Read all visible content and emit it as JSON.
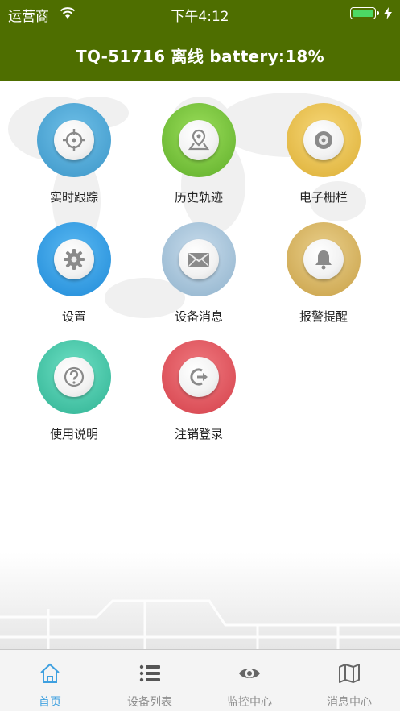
{
  "status_bar": {
    "carrier": "运营商",
    "time": "下午4:12"
  },
  "header": {
    "title": "TQ-51716 离线 battery:18%"
  },
  "menu": [
    {
      "label": "实时跟踪",
      "icon": "crosshair-icon",
      "color": "#4aa6d6"
    },
    {
      "label": "历史轨迹",
      "icon": "map-pin-icon",
      "color": "#7cc63c"
    },
    {
      "label": "电子栅栏",
      "icon": "disc-icon",
      "color": "#e9c14d"
    },
    {
      "label": "设置",
      "icon": "gear-icon",
      "color": "#2d9fe8"
    },
    {
      "label": "设备消息",
      "icon": "envelope-icon",
      "color": "#a9c6dc"
    },
    {
      "label": "报警提醒",
      "icon": "bell-icon",
      "color": "#d9b663"
    },
    {
      "label": "使用说明",
      "icon": "question-icon",
      "color": "#3ec7a8"
    },
    {
      "label": "注销登录",
      "icon": "logout-icon",
      "color": "#e0505a"
    }
  ],
  "tabs": [
    {
      "label": "首页",
      "icon": "home-icon",
      "active": true
    },
    {
      "label": "设备列表",
      "icon": "list-icon",
      "active": false
    },
    {
      "label": "监控中心",
      "icon": "eye-icon",
      "active": false
    },
    {
      "label": "消息中心",
      "icon": "map-icon",
      "active": false
    }
  ],
  "colors": {
    "header_bg": "#4e6e00",
    "active_tab": "#3ea0e0",
    "inactive_tab": "#8e8e8e"
  }
}
